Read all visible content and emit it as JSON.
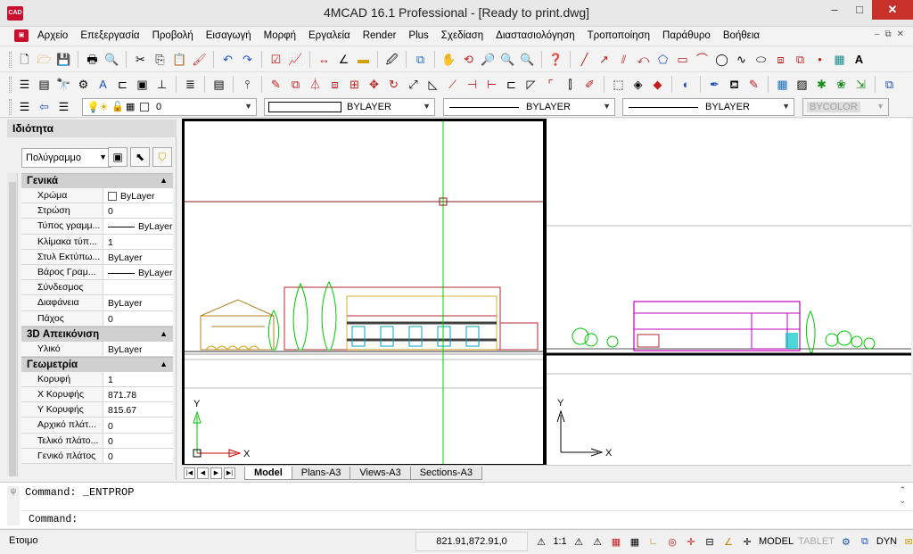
{
  "window": {
    "title": "4MCAD 16.1 Professional - [Ready to print.dwg]",
    "app_icon_text": "CAD",
    "minimize": "‒",
    "maximize": "□",
    "close": "✕"
  },
  "menu": {
    "items": [
      "Αρχείο",
      "Επεξεργασία",
      "Προβολή",
      "Εισαγωγή",
      "Μορφή",
      "Εργαλεία",
      "Render",
      "Plus",
      "Σχεδίαση",
      "Διαστασιολόγηση",
      "Τροποποίηση",
      "Παράθυρο",
      "Βοήθεια"
    ],
    "mdi_min": "‒",
    "mdi_restore": "⧉",
    "mdi_close": "✕"
  },
  "propbar": {
    "layer": "0",
    "linetype": "BYLAYER",
    "lineweight": "BYLAYER",
    "linestyle": "BYLAYER",
    "color": "BYCOLOR"
  },
  "panel": {
    "title": "Ιδιότητα",
    "object_type": "Πολύγραμμο",
    "groups": [
      {
        "name": "Γενικά",
        "rows": [
          {
            "name": "Χρώμα",
            "value": "ByLayer",
            "kind": "swatch"
          },
          {
            "name": "Στρώση",
            "value": "0"
          },
          {
            "name": "Τύπος γραμμ...",
            "value": "ByLayer",
            "kind": "line"
          },
          {
            "name": "Κλίμακα τύπ...",
            "value": "1"
          },
          {
            "name": "Στυλ Εκτύπω...",
            "value": "ByLayer"
          },
          {
            "name": "Βάρος Γραμ...",
            "value": "ByLayer",
            "kind": "line"
          },
          {
            "name": "Σύνδεσμος",
            "value": ""
          },
          {
            "name": "Διαφάνεια",
            "value": "ByLayer"
          },
          {
            "name": "Πάχος",
            "value": "0"
          }
        ]
      },
      {
        "name": "3D Απεικόνιση",
        "rows": [
          {
            "name": "Υλικό",
            "value": "ByLayer"
          }
        ]
      },
      {
        "name": "Γεωμετρία",
        "rows": [
          {
            "name": "Κορυφή",
            "value": "1"
          },
          {
            "name": "Χ Κορυφής",
            "value": "871.78"
          },
          {
            "name": "Υ Κορυφής",
            "value": "815.67"
          },
          {
            "name": "Αρχικό πλάτ...",
            "value": "0"
          },
          {
            "name": "Τελικό πλάτο...",
            "value": "0"
          },
          {
            "name": "Γενικό πλάτος",
            "value": "0"
          }
        ]
      }
    ]
  },
  "viewports": {
    "ucs_y": "Y",
    "ucs_x": "X"
  },
  "tabs": {
    "items": [
      "Model",
      "Plans-A3",
      "Views-A3",
      "Sections-A3"
    ],
    "active": "Model"
  },
  "command": {
    "history": "Command: _ENTPROP",
    "prompt": "Command:",
    "grip_label": "ψ"
  },
  "status": {
    "text": "Ετοιμο",
    "coords": "821.91,872.91,0",
    "scale": "1:1",
    "model": "MODEL",
    "tablet": "TABLET",
    "dyn": "DYN"
  },
  "colors": {
    "crosshair": "#8b1a1a",
    "cursor_line": "#00d000",
    "building": "#b0282f",
    "trees": "#00c800",
    "magenta": "#c000c0",
    "cyan": "#00c8c8"
  }
}
